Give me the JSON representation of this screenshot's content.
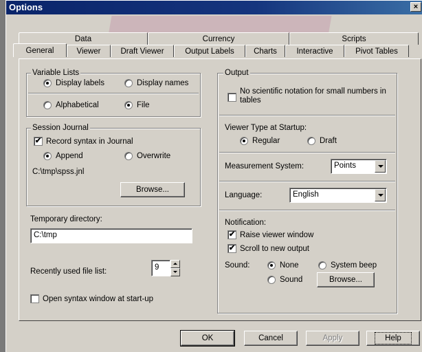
{
  "window": {
    "title": "Options",
    "close_glyph": "×"
  },
  "tabs": {
    "row_back": [
      "Data",
      "Currency",
      "Scripts"
    ],
    "row_front": [
      "General",
      "Viewer",
      "Draft Viewer",
      "Output Labels",
      "Charts",
      "Interactive",
      "Pivot Tables"
    ],
    "active": "General"
  },
  "variable_lists": {
    "title": "Variable Lists",
    "display_labels": "Display labels",
    "display_names": "Display names",
    "alphabetical": "Alphabetical",
    "file": "File",
    "selected_display": "Display labels",
    "selected_order": "File"
  },
  "session_journal": {
    "title": "Session Journal",
    "record_label": "Record syntax in Journal",
    "record_checked": true,
    "append": "Append",
    "overwrite": "Overwrite",
    "selected": "Append",
    "path": "C:\\tmp\\spss.jnl",
    "browse": "Browse..."
  },
  "temp_dir": {
    "label": "Temporary directory:",
    "value": "C:\\tmp"
  },
  "recent_files": {
    "label": "Recently used file list:",
    "value": "9"
  },
  "open_syntax": {
    "label": "Open syntax window at start-up",
    "checked": false
  },
  "output": {
    "title": "Output",
    "no_sci_label": "No scientific notation for small numbers in tables",
    "no_sci_checked": false,
    "viewer_type_label": "Viewer Type at Startup:",
    "regular": "Regular",
    "draft": "Draft",
    "viewer_selected": "Regular",
    "measurement_label": "Measurement System:",
    "measurement_value": "Points",
    "language_label": "Language:",
    "language_value": "English",
    "notification_label": "Notification:",
    "raise_viewer": "Raise viewer window",
    "raise_checked": true,
    "scroll_new": "Scroll to new output",
    "scroll_checked": true,
    "sound_label": "Sound:",
    "none": "None",
    "system_beep": "System beep",
    "sound": "Sound",
    "sound_selected": "None",
    "browse": "Browse..."
  },
  "buttons": {
    "ok": "OK",
    "cancel": "Cancel",
    "apply": "Apply",
    "help": "Help"
  },
  "check_glyph": "✔"
}
